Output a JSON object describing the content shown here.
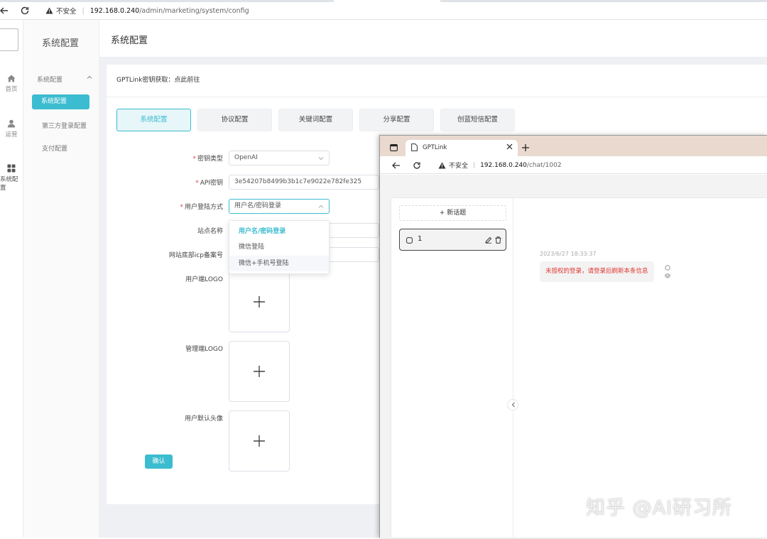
{
  "browser": {
    "security_label": "不安全",
    "url_host": "192.168.0.240",
    "url_path": "/admin/marketing/system/config"
  },
  "rail": {
    "items": [
      {
        "label": "首页",
        "icon": "home-icon"
      },
      {
        "label": "运营",
        "icon": "user-icon"
      },
      {
        "label": "系统配置",
        "icon": "grid-icon"
      }
    ]
  },
  "submenu": {
    "title": "系统配置",
    "group": "系统配置",
    "items": [
      "系统配置",
      "第三方登录配置",
      "支付配置"
    ]
  },
  "page": {
    "title": "系统配置",
    "notice": "GPTLink密钥获取：点此前往"
  },
  "tabs": [
    "系统配置",
    "协议配置",
    "关键词配置",
    "分享配置",
    "创蓝短信配置"
  ],
  "form": {
    "key_type_label": "密钥类型",
    "key_type_value": "OpenAI",
    "api_key_label": "API密钥",
    "api_key_value": "3e54207b8499b3b1c7e9022e782fe325",
    "login_mode_label": "用户登陆方式",
    "login_mode_value": "用户名/密码登录",
    "site_name_label": "站点名称",
    "icp_label": "网站底部icp备案号",
    "user_logo_label": "用户端LOGO",
    "admin_logo_label": "管理端LOGO",
    "avatar_label": "用户默认头像",
    "confirm": "确认"
  },
  "dropdown": {
    "options": [
      "用户名/密码登录",
      "微信登陆",
      "微信+手机号登陆"
    ],
    "selected": "用户名/密码登录"
  },
  "overlay": {
    "tab_title": "GPTLink",
    "security_label": "不安全",
    "url_host": "192.168.0.240",
    "url_path": "/chat/1002",
    "new_chat": "+ 新话题",
    "conversation": "1",
    "timestamp": "2023/6/27 18:33:37",
    "message": "未授权的登录，请登录后刷新本条信息"
  },
  "watermark": "知乎 @AI研习所",
  "colors": {
    "accent": "#3cbcd0",
    "error": "#e0362f",
    "overlay_tabbar": "#e9d9cf"
  }
}
